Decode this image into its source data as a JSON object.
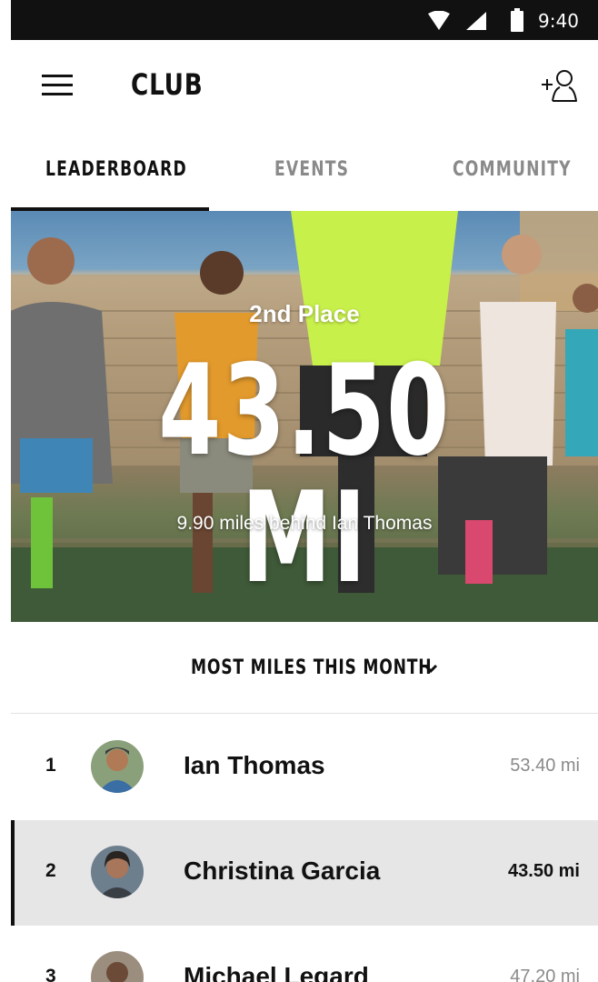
{
  "status_bar": {
    "time": "9:40",
    "icons": [
      "wifi-icon",
      "signal-icon",
      "battery-icon"
    ]
  },
  "app_bar": {
    "title": "CLUB",
    "menu_icon": "menu-icon",
    "add_friend_icon": "add-friend-icon"
  },
  "tabs": [
    {
      "label": "LEADERBOARD",
      "active": true
    },
    {
      "label": "EVENTS",
      "active": false
    },
    {
      "label": "COMMUNITY",
      "active": false
    }
  ],
  "hero": {
    "place": "2nd Place",
    "distance": "43.50 MI",
    "behind_text": "9.90 miles behind Ian Thomas"
  },
  "filter": {
    "label": "MOST MILES THIS MONTH",
    "icon": "chevron-down-icon"
  },
  "leaderboard": [
    {
      "rank": "1",
      "name": "Ian Thomas",
      "miles": "53.40 mi",
      "current_user": false
    },
    {
      "rank": "2",
      "name": "Christina Garcia",
      "miles": "43.50 mi",
      "current_user": true
    },
    {
      "rank": "3",
      "name": "Michael Legard",
      "miles": "47.20 mi",
      "current_user": false
    }
  ],
  "colors": {
    "text": "#111111",
    "muted": "#8a8a8a",
    "highlight_row": "#e6e6e6",
    "status_bar": "#111111"
  }
}
